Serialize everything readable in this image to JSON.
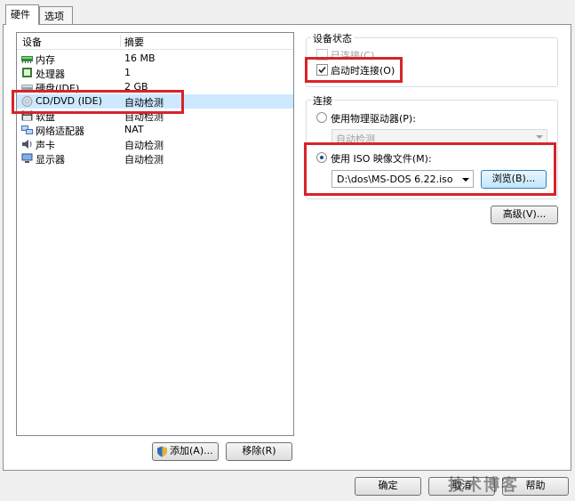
{
  "tabs": [
    {
      "label": "硬件"
    },
    {
      "label": "选项"
    }
  ],
  "device_list": {
    "col_device": "设备",
    "col_summary": "摘要",
    "rows": [
      {
        "name": "内存",
        "summary": "16 MB",
        "icon": "memory-icon"
      },
      {
        "name": "处理器",
        "summary": "1",
        "icon": "processor-icon"
      },
      {
        "name": "硬盘(IDE)",
        "summary": "2 GB",
        "icon": "harddisk-icon"
      },
      {
        "name": "CD/DVD (IDE)",
        "summary": "自动检测",
        "icon": "cdrom-icon"
      },
      {
        "name": "软盘",
        "summary": "自动检测",
        "icon": "floppy-icon"
      },
      {
        "name": "网络适配器",
        "summary": "NAT",
        "icon": "network-icon"
      },
      {
        "name": "声卡",
        "summary": "自动检测",
        "icon": "sound-icon"
      },
      {
        "name": "显示器",
        "summary": "自动检测",
        "icon": "display-icon"
      }
    ],
    "selected_index": 3
  },
  "list_buttons": {
    "add": "添加(A)...",
    "remove": "移除(R)"
  },
  "device_status": {
    "title": "设备状态",
    "connected": "已连接(C)",
    "connect_at_power_on": "启动时连接(O)"
  },
  "connection": {
    "title": "连接",
    "physical_drive": "使用物理驱动器(P):",
    "physical_drive_value": "自动检测",
    "iso": "使用 ISO 映像文件(M):",
    "iso_path": "D:\\dos\\MS-DOS 6.22.iso",
    "browse": "浏览(B)...",
    "advanced": "高级(V)..."
  },
  "footer": {
    "ok": "确定",
    "cancel": "取消",
    "help": "帮助"
  },
  "watermark": "技术博客",
  "colors": {
    "highlight": "#d8232a",
    "selection": "#cde8ff"
  }
}
